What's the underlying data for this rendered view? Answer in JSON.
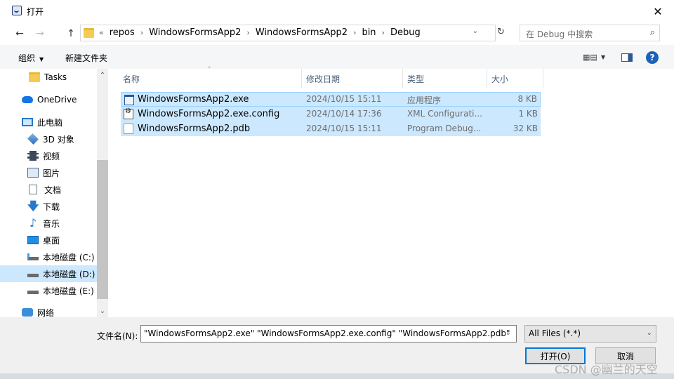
{
  "window": {
    "title": "打开",
    "close_glyph": "✕"
  },
  "nav": {
    "back": "←",
    "forward": "→",
    "up": "↑"
  },
  "address": {
    "lead": "«",
    "crumbs": [
      "repos",
      "WindowsFormsApp2",
      "WindowsFormsApp2",
      "bin",
      "Debug"
    ],
    "sep": "›",
    "dropdown": "⌄",
    "refresh": "↻"
  },
  "search": {
    "placeholder": "在 Debug 中搜索",
    "icon": "⌕"
  },
  "toolbar": {
    "organize": "组织",
    "new_folder": "新建文件夹",
    "caret": "▼",
    "help": "?"
  },
  "sidebar": {
    "items": [
      {
        "label": "Tasks",
        "icon": "folder"
      },
      {
        "label": "OneDrive",
        "icon": "cloud"
      },
      {
        "label": "此电脑",
        "icon": "pc"
      },
      {
        "label": "3D 对象",
        "icon": "3d"
      },
      {
        "label": "视频",
        "icon": "video"
      },
      {
        "label": "图片",
        "icon": "pictures"
      },
      {
        "label": "文档",
        "icon": "documents"
      },
      {
        "label": "下载",
        "icon": "download",
        "glyph": "🡇"
      },
      {
        "label": "音乐",
        "icon": "music",
        "glyph": "♪"
      },
      {
        "label": "桌面",
        "icon": "desktop"
      },
      {
        "label": "本地磁盘 (C:)",
        "icon": "drive-c"
      },
      {
        "label": "本地磁盘 (D:)",
        "icon": "drive",
        "selected": true
      },
      {
        "label": "本地磁盘 (E:)",
        "icon": "drive"
      },
      {
        "label": "网络",
        "icon": "network"
      }
    ],
    "scroll_up": "⌃",
    "scroll_down": "⌄"
  },
  "columns": [
    "名称",
    "修改日期",
    "类型",
    "大小"
  ],
  "sort_glyph": "˄",
  "files": [
    {
      "name": "WindowsFormsApp2.exe",
      "date": "2024/10/15 15:11",
      "type": "应用程序",
      "size": "8 KB",
      "icon": "exe"
    },
    {
      "name": "WindowsFormsApp2.exe.config",
      "date": "2024/10/14 17:36",
      "type": "XML Configurati...",
      "size": "1 KB",
      "icon": "config"
    },
    {
      "name": "WindowsFormsApp2.pdb",
      "date": "2024/10/15 15:11",
      "type": "Program Debug...",
      "size": "32 KB",
      "icon": "pdb"
    }
  ],
  "footer": {
    "filename_label": "文件名(N):",
    "filename_value": "\"WindowsFormsApp2.exe\" \"WindowsFormsApp2.exe.config\" \"WindowsFormsApp2.pdb\"",
    "filter": "All Files (*.*)",
    "dropdown": "⌄",
    "open": "打开(O)",
    "cancel": "取消"
  },
  "watermark": "CSDN @幽兰的天空"
}
